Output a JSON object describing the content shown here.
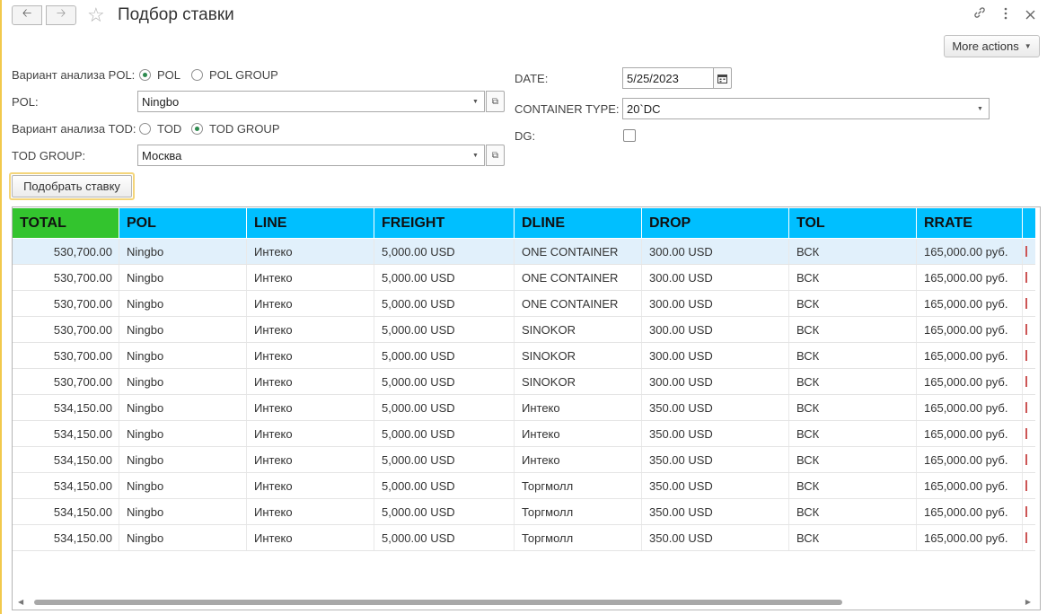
{
  "window": {
    "title": "Подбор ставки",
    "more_actions": "More actions"
  },
  "form": {
    "pol_variant_label": "Вариант анализа POL:",
    "pol_variant_options": [
      "POL",
      "POL GROUP"
    ],
    "pol_variant_selected": "POL",
    "pol_label": "POL:",
    "pol_value": "Ningbo",
    "tod_variant_label": "Вариант анализа TOD:",
    "tod_variant_options": [
      "TOD",
      "TOD GROUP"
    ],
    "tod_variant_selected": "TOD GROUP",
    "tod_group_label": "TOD GROUP:",
    "tod_group_value": "Москва",
    "date_label": "DATE:",
    "date_value": "5/25/2023",
    "container_type_label": "CONTAINER TYPE:",
    "container_type_value": "20`DC",
    "dg_label": "DG:",
    "dg_checked": false,
    "pick_button": "Подобрать ставку"
  },
  "table": {
    "columns": [
      "TOTAL",
      "POL",
      "LINE",
      "FREIGHT",
      "DLINE",
      "DROP",
      "TOL",
      "RRATE"
    ],
    "rows": [
      [
        "530,700.00",
        "Ningbo",
        "Интеко",
        "5,000.00 USD",
        "ONE CONTAINER",
        "300.00 USD",
        "ВСК",
        "165,000.00 руб."
      ],
      [
        "530,700.00",
        "Ningbo",
        "Интеко",
        "5,000.00 USD",
        "ONE CONTAINER",
        "300.00 USD",
        "ВСК",
        "165,000.00 руб."
      ],
      [
        "530,700.00",
        "Ningbo",
        "Интеко",
        "5,000.00 USD",
        "ONE CONTAINER",
        "300.00 USD",
        "ВСК",
        "165,000.00 руб."
      ],
      [
        "530,700.00",
        "Ningbo",
        "Интеко",
        "5,000.00 USD",
        "SINOKOR",
        "300.00 USD",
        "ВСК",
        "165,000.00 руб."
      ],
      [
        "530,700.00",
        "Ningbo",
        "Интеко",
        "5,000.00 USD",
        "SINOKOR",
        "300.00 USD",
        "ВСК",
        "165,000.00 руб."
      ],
      [
        "530,700.00",
        "Ningbo",
        "Интеко",
        "5,000.00 USD",
        "SINOKOR",
        "300.00 USD",
        "ВСК",
        "165,000.00 руб."
      ],
      [
        "534,150.00",
        "Ningbo",
        "Интеко",
        "5,000.00 USD",
        "Интеко",
        "350.00 USD",
        "ВСК",
        "165,000.00 руб."
      ],
      [
        "534,150.00",
        "Ningbo",
        "Интеко",
        "5,000.00 USD",
        "Интеко",
        "350.00 USD",
        "ВСК",
        "165,000.00 руб."
      ],
      [
        "534,150.00",
        "Ningbo",
        "Интеко",
        "5,000.00 USD",
        "Интеко",
        "350.00 USD",
        "ВСК",
        "165,000.00 руб."
      ],
      [
        "534,150.00",
        "Ningbo",
        "Интеко",
        "5,000.00 USD",
        "Торгмолл",
        "350.00 USD",
        "ВСК",
        "165,000.00 руб."
      ],
      [
        "534,150.00",
        "Ningbo",
        "Интеко",
        "5,000.00 USD",
        "Торгмолл",
        "350.00 USD",
        "ВСК",
        "165,000.00 руб."
      ],
      [
        "534,150.00",
        "Ningbo",
        "Интеко",
        "5,000.00 USD",
        "Торгмолл",
        "350.00 USD",
        "ВСК",
        "165,000.00 руб."
      ]
    ],
    "selected_row": 0
  },
  "colors": {
    "header_blue": "#00bfff",
    "header_green": "#33c42e",
    "selected_row": "#e1f0fb",
    "radio_accent": "#2d8a4e"
  },
  "icons": {
    "back": "arrow-left-icon",
    "forward": "arrow-right-icon",
    "favorite": "star-icon",
    "link": "link-icon",
    "menu": "kebab-icon",
    "close": "close-icon",
    "calendar": "calendar-icon"
  }
}
